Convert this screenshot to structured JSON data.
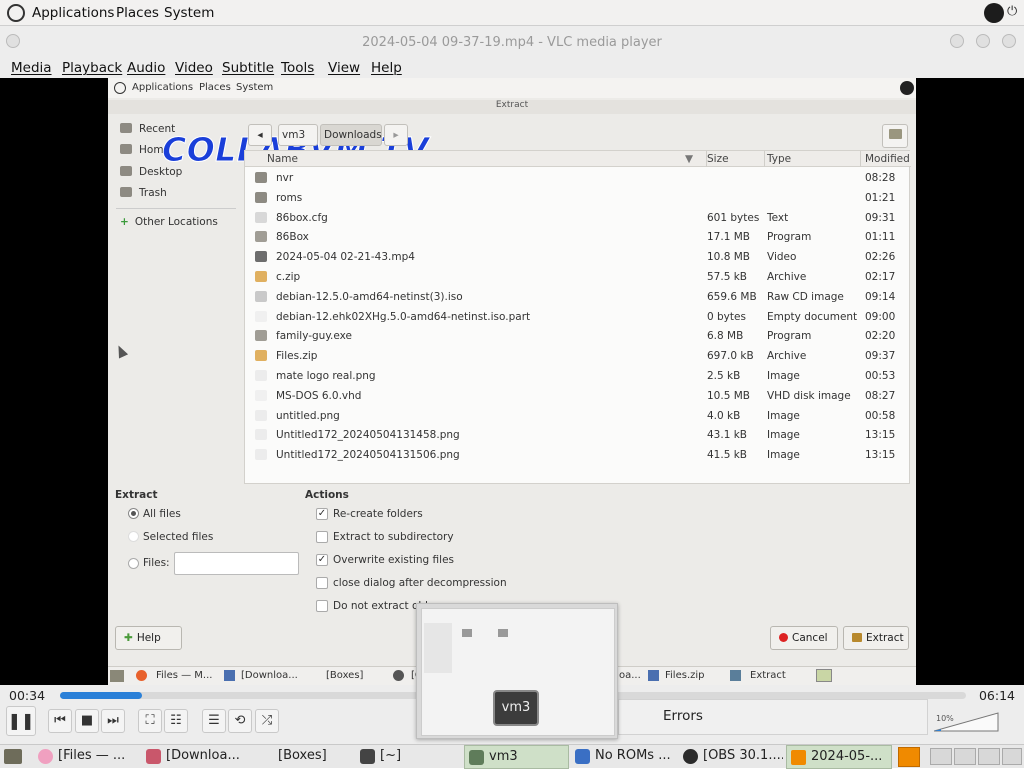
{
  "top_panel": {
    "menus": [
      "Applications",
      "Places",
      "System"
    ]
  },
  "vlc": {
    "title": "2024-05-04 09-37-19.mp4 - VLC media player",
    "menus": [
      "Media",
      "Playback",
      "Audio",
      "Video",
      "Subtitle",
      "Tools",
      "View",
      "Help"
    ],
    "elapsed": "00:34",
    "total": "06:14",
    "progress": 0.091,
    "errors_label": "Errors",
    "volume_label": "10%"
  },
  "inner": {
    "panel_menus": [
      "Applications",
      "Places",
      "System"
    ],
    "dialog_title": "Extract",
    "watermark": "COLLABVM TV",
    "sidebar": [
      "Recent",
      "Home",
      "Desktop",
      "Trash",
      "Other Locations"
    ],
    "path": [
      "vm3",
      "Downloads"
    ],
    "columns": [
      "Name",
      "Size",
      "Type",
      "Modified"
    ],
    "files": [
      {
        "name": "nvr",
        "size": "",
        "type": "",
        "modified": "08:28",
        "icon": "folder"
      },
      {
        "name": "roms",
        "size": "",
        "type": "",
        "modified": "01:21",
        "icon": "folder"
      },
      {
        "name": "86box.cfg",
        "size": "601 bytes",
        "type": "Text",
        "modified": "09:31",
        "icon": "text"
      },
      {
        "name": "86Box",
        "size": "17.1 MB",
        "type": "Program",
        "modified": "01:11",
        "icon": "program"
      },
      {
        "name": "2024-05-04 02-21-43.mp4",
        "size": "10.8 MB",
        "type": "Video",
        "modified": "02:26",
        "icon": "video"
      },
      {
        "name": "c.zip",
        "size": "57.5 kB",
        "type": "Archive",
        "modified": "02:17",
        "icon": "archive"
      },
      {
        "name": "debian-12.5.0-amd64-netinst(3).iso",
        "size": "659.6 MB",
        "type": "Raw CD image",
        "modified": "09:14",
        "icon": "disc"
      },
      {
        "name": "debian-12.ehk02XHg.5.0-amd64-netinst.iso.part",
        "size": "0 bytes",
        "type": "Empty document",
        "modified": "09:00",
        "icon": "blank"
      },
      {
        "name": "family-guy.exe",
        "size": "6.8 MB",
        "type": "Program",
        "modified": "02:20",
        "icon": "program"
      },
      {
        "name": "Files.zip",
        "size": "697.0 kB",
        "type": "Archive",
        "modified": "09:37",
        "icon": "archive"
      },
      {
        "name": "mate logo real.png",
        "size": "2.5 kB",
        "type": "Image",
        "modified": "00:53",
        "icon": "image"
      },
      {
        "name": "MS-DOS 6.0.vhd",
        "size": "10.5 MB",
        "type": "VHD disk image",
        "modified": "08:27",
        "icon": "blank"
      },
      {
        "name": "untitled.png",
        "size": "4.0 kB",
        "type": "Image",
        "modified": "00:58",
        "icon": "image"
      },
      {
        "name": "Untitled172_20240504131458.png",
        "size": "43.1 kB",
        "type": "Image",
        "modified": "13:15",
        "icon": "image"
      },
      {
        "name": "Untitled172_20240504131506.png",
        "size": "41.5 kB",
        "type": "Image",
        "modified": "13:15",
        "icon": "image"
      }
    ],
    "extract": {
      "heading": "Extract",
      "all_files": "All files",
      "selected_files": "Selected files",
      "files_label": "Files:"
    },
    "actions": {
      "heading": "Actions",
      "items": [
        {
          "label": "Re-create folders",
          "checked": true
        },
        {
          "label": "Extract to subdirectory",
          "checked": false
        },
        {
          "label": "Overwrite existing files",
          "checked": true
        },
        {
          "label": "close dialog after decompression",
          "checked": false
        },
        {
          "label": "Do not extract old",
          "checked": false
        }
      ]
    },
    "buttons": {
      "help": "Help",
      "cancel": "Cancel",
      "extract": "Extract"
    },
    "taskbar": [
      "Files — M...",
      "[Downloa...",
      "[Boxes]",
      "[G",
      "oa...",
      "Files.zip",
      "Extract"
    ]
  },
  "thumbnail": {
    "label": "vm3"
  },
  "taskbar": {
    "items": [
      "[Files — ...",
      "[Downloa...",
      "[Boxes]",
      "[~]",
      "vm3",
      "No ROMs ...",
      "[OBS 30.1....",
      "2024-05-..."
    ]
  },
  "colors": {
    "accent": "#2a80d8",
    "video_bg": "#000000",
    "watermark": "#1a3fd9"
  }
}
